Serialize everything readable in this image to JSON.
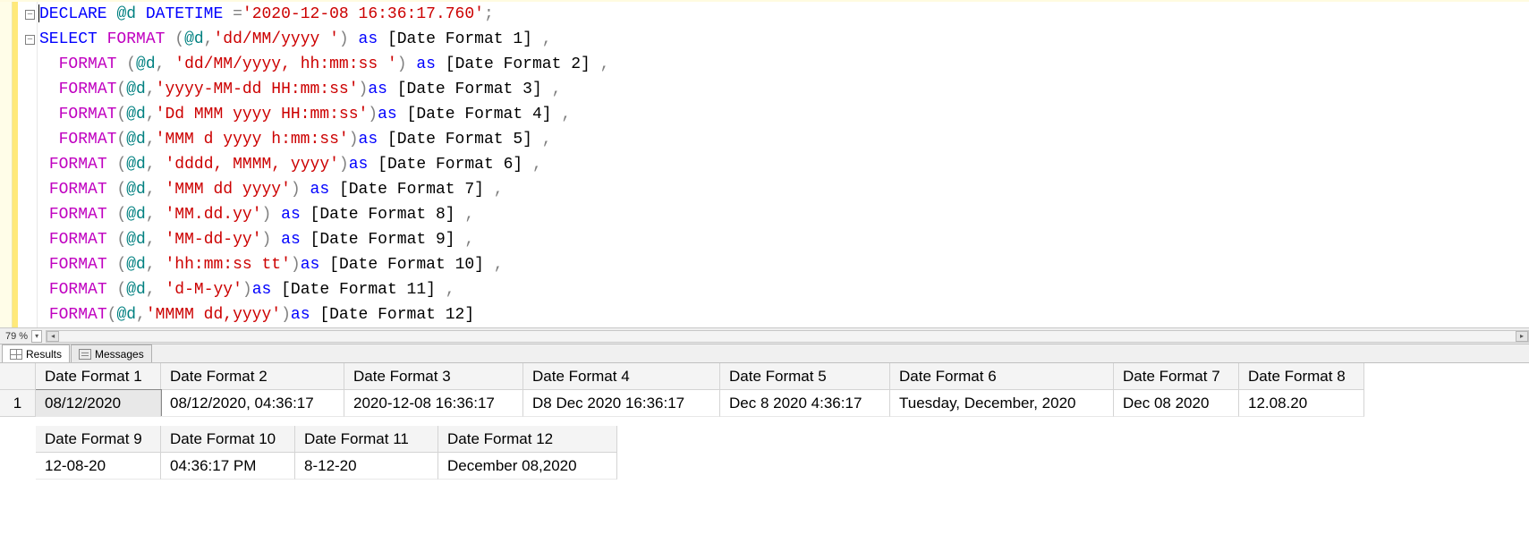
{
  "zoom": {
    "percent": "79 %"
  },
  "tabs": {
    "results": "Results",
    "messages": "Messages"
  },
  "code": {
    "lines": [
      [
        {
          "t": "kw",
          "v": "DECLARE"
        },
        {
          "t": "txt",
          "v": " "
        },
        {
          "t": "var",
          "v": "@d"
        },
        {
          "t": "txt",
          "v": " "
        },
        {
          "t": "kw",
          "v": "DATETIME"
        },
        {
          "t": "txt",
          "v": " "
        },
        {
          "t": "punc",
          "v": "="
        },
        {
          "t": "str",
          "v": "'2020-12-08 16:36:17.760'"
        },
        {
          "t": "punc",
          "v": ";"
        }
      ],
      [
        {
          "t": "kw",
          "v": "SELECT"
        },
        {
          "t": "txt",
          "v": " "
        },
        {
          "t": "fn",
          "v": "FORMAT"
        },
        {
          "t": "txt",
          "v": " "
        },
        {
          "t": "punc",
          "v": "("
        },
        {
          "t": "var",
          "v": "@d"
        },
        {
          "t": "punc",
          "v": ","
        },
        {
          "t": "str",
          "v": "'dd/MM/yyyy '"
        },
        {
          "t": "punc",
          "v": ")"
        },
        {
          "t": "txt",
          "v": " "
        },
        {
          "t": "kw",
          "v": "as"
        },
        {
          "t": "txt",
          "v": " [Date Format 1] "
        },
        {
          "t": "punc",
          "v": ","
        }
      ],
      [
        {
          "t": "txt",
          "v": "  "
        },
        {
          "t": "fn",
          "v": "FORMAT"
        },
        {
          "t": "txt",
          "v": " "
        },
        {
          "t": "punc",
          "v": "("
        },
        {
          "t": "var",
          "v": "@d"
        },
        {
          "t": "punc",
          "v": ","
        },
        {
          "t": "txt",
          "v": " "
        },
        {
          "t": "str",
          "v": "'dd/MM/yyyy, hh:mm:ss '"
        },
        {
          "t": "punc",
          "v": ")"
        },
        {
          "t": "txt",
          "v": " "
        },
        {
          "t": "kw",
          "v": "as"
        },
        {
          "t": "txt",
          "v": " [Date Format 2] "
        },
        {
          "t": "punc",
          "v": ","
        }
      ],
      [
        {
          "t": "txt",
          "v": "  "
        },
        {
          "t": "fn",
          "v": "FORMAT"
        },
        {
          "t": "punc",
          "v": "("
        },
        {
          "t": "var",
          "v": "@d"
        },
        {
          "t": "punc",
          "v": ","
        },
        {
          "t": "str",
          "v": "'yyyy-MM-dd HH:mm:ss'"
        },
        {
          "t": "punc",
          "v": ")"
        },
        {
          "t": "kw",
          "v": "as"
        },
        {
          "t": "txt",
          "v": " [Date Format 3] "
        },
        {
          "t": "punc",
          "v": ","
        }
      ],
      [
        {
          "t": "txt",
          "v": "  "
        },
        {
          "t": "fn",
          "v": "FORMAT"
        },
        {
          "t": "punc",
          "v": "("
        },
        {
          "t": "var",
          "v": "@d"
        },
        {
          "t": "punc",
          "v": ","
        },
        {
          "t": "str",
          "v": "'Dd MMM yyyy HH:mm:ss'"
        },
        {
          "t": "punc",
          "v": ")"
        },
        {
          "t": "kw",
          "v": "as"
        },
        {
          "t": "txt",
          "v": " [Date Format 4] "
        },
        {
          "t": "punc",
          "v": ","
        }
      ],
      [
        {
          "t": "txt",
          "v": "  "
        },
        {
          "t": "fn",
          "v": "FORMAT"
        },
        {
          "t": "punc",
          "v": "("
        },
        {
          "t": "var",
          "v": "@d"
        },
        {
          "t": "punc",
          "v": ","
        },
        {
          "t": "str",
          "v": "'MMM d yyyy h:mm:ss'"
        },
        {
          "t": "punc",
          "v": ")"
        },
        {
          "t": "kw",
          "v": "as"
        },
        {
          "t": "txt",
          "v": " [Date Format 5] "
        },
        {
          "t": "punc",
          "v": ","
        }
      ],
      [
        {
          "t": "txt",
          "v": " "
        },
        {
          "t": "fn",
          "v": "FORMAT"
        },
        {
          "t": "txt",
          "v": " "
        },
        {
          "t": "punc",
          "v": "("
        },
        {
          "t": "var",
          "v": "@d"
        },
        {
          "t": "punc",
          "v": ","
        },
        {
          "t": "txt",
          "v": " "
        },
        {
          "t": "str",
          "v": "'dddd, MMMM, yyyy'"
        },
        {
          "t": "punc",
          "v": ")"
        },
        {
          "t": "kw",
          "v": "as"
        },
        {
          "t": "txt",
          "v": " [Date Format 6] "
        },
        {
          "t": "punc",
          "v": ","
        }
      ],
      [
        {
          "t": "txt",
          "v": " "
        },
        {
          "t": "fn",
          "v": "FORMAT"
        },
        {
          "t": "txt",
          "v": " "
        },
        {
          "t": "punc",
          "v": "("
        },
        {
          "t": "var",
          "v": "@d"
        },
        {
          "t": "punc",
          "v": ","
        },
        {
          "t": "txt",
          "v": " "
        },
        {
          "t": "str",
          "v": "'MMM dd yyyy'"
        },
        {
          "t": "punc",
          "v": ")"
        },
        {
          "t": "txt",
          "v": " "
        },
        {
          "t": "kw",
          "v": "as"
        },
        {
          "t": "txt",
          "v": " [Date Format 7] "
        },
        {
          "t": "punc",
          "v": ","
        }
      ],
      [
        {
          "t": "txt",
          "v": " "
        },
        {
          "t": "fn",
          "v": "FORMAT"
        },
        {
          "t": "txt",
          "v": " "
        },
        {
          "t": "punc",
          "v": "("
        },
        {
          "t": "var",
          "v": "@d"
        },
        {
          "t": "punc",
          "v": ","
        },
        {
          "t": "txt",
          "v": " "
        },
        {
          "t": "str",
          "v": "'MM.dd.yy'"
        },
        {
          "t": "punc",
          "v": ")"
        },
        {
          "t": "txt",
          "v": " "
        },
        {
          "t": "kw",
          "v": "as"
        },
        {
          "t": "txt",
          "v": " [Date Format 8] "
        },
        {
          "t": "punc",
          "v": ","
        }
      ],
      [
        {
          "t": "txt",
          "v": " "
        },
        {
          "t": "fn",
          "v": "FORMAT"
        },
        {
          "t": "txt",
          "v": " "
        },
        {
          "t": "punc",
          "v": "("
        },
        {
          "t": "var",
          "v": "@d"
        },
        {
          "t": "punc",
          "v": ","
        },
        {
          "t": "txt",
          "v": " "
        },
        {
          "t": "str",
          "v": "'MM-dd-yy'"
        },
        {
          "t": "punc",
          "v": ")"
        },
        {
          "t": "txt",
          "v": " "
        },
        {
          "t": "kw",
          "v": "as"
        },
        {
          "t": "txt",
          "v": " [Date Format 9] "
        },
        {
          "t": "punc",
          "v": ","
        }
      ],
      [
        {
          "t": "txt",
          "v": " "
        },
        {
          "t": "fn",
          "v": "FORMAT"
        },
        {
          "t": "txt",
          "v": " "
        },
        {
          "t": "punc",
          "v": "("
        },
        {
          "t": "var",
          "v": "@d"
        },
        {
          "t": "punc",
          "v": ","
        },
        {
          "t": "txt",
          "v": " "
        },
        {
          "t": "str",
          "v": "'hh:mm:ss tt'"
        },
        {
          "t": "punc",
          "v": ")"
        },
        {
          "t": "kw",
          "v": "as"
        },
        {
          "t": "txt",
          "v": " [Date Format 10] "
        },
        {
          "t": "punc",
          "v": ","
        }
      ],
      [
        {
          "t": "txt",
          "v": " "
        },
        {
          "t": "fn",
          "v": "FORMAT"
        },
        {
          "t": "txt",
          "v": " "
        },
        {
          "t": "punc",
          "v": "("
        },
        {
          "t": "var",
          "v": "@d"
        },
        {
          "t": "punc",
          "v": ","
        },
        {
          "t": "txt",
          "v": " "
        },
        {
          "t": "str",
          "v": "'d-M-yy'"
        },
        {
          "t": "punc",
          "v": ")"
        },
        {
          "t": "kw",
          "v": "as"
        },
        {
          "t": "txt",
          "v": " [Date Format 11] "
        },
        {
          "t": "punc",
          "v": ","
        }
      ],
      [
        {
          "t": "txt",
          "v": " "
        },
        {
          "t": "fn",
          "v": "FORMAT"
        },
        {
          "t": "punc",
          "v": "("
        },
        {
          "t": "var",
          "v": "@d"
        },
        {
          "t": "punc",
          "v": ","
        },
        {
          "t": "str",
          "v": "'MMMM dd,yyyy'"
        },
        {
          "t": "punc",
          "v": ")"
        },
        {
          "t": "kw",
          "v": "as"
        },
        {
          "t": "txt",
          "v": " [Date Format 12]"
        }
      ]
    ]
  },
  "results": {
    "rownum": "1",
    "group1": {
      "headers": [
        "Date Format 1",
        "Date Format 2",
        "Date Format 3",
        "Date Format 4",
        "Date Format 5",
        "Date Format 6",
        "Date Format 7",
        "Date Format 8"
      ],
      "row": [
        "08/12/2020",
        "08/12/2020, 04:36:17",
        "2020-12-08 16:36:17",
        "D8 Dec 2020 16:36:17",
        "Dec 8 2020 4:36:17",
        "Tuesday, December, 2020",
        "Dec 08 2020",
        "12.08.20"
      ]
    },
    "group2": {
      "headers": [
        "Date Format 9",
        "Date Format 10",
        "Date Format 11",
        "Date Format 12"
      ],
      "row": [
        "12-08-20",
        "04:36:17 PM",
        "8-12-20",
        "December 08,2020"
      ]
    }
  }
}
